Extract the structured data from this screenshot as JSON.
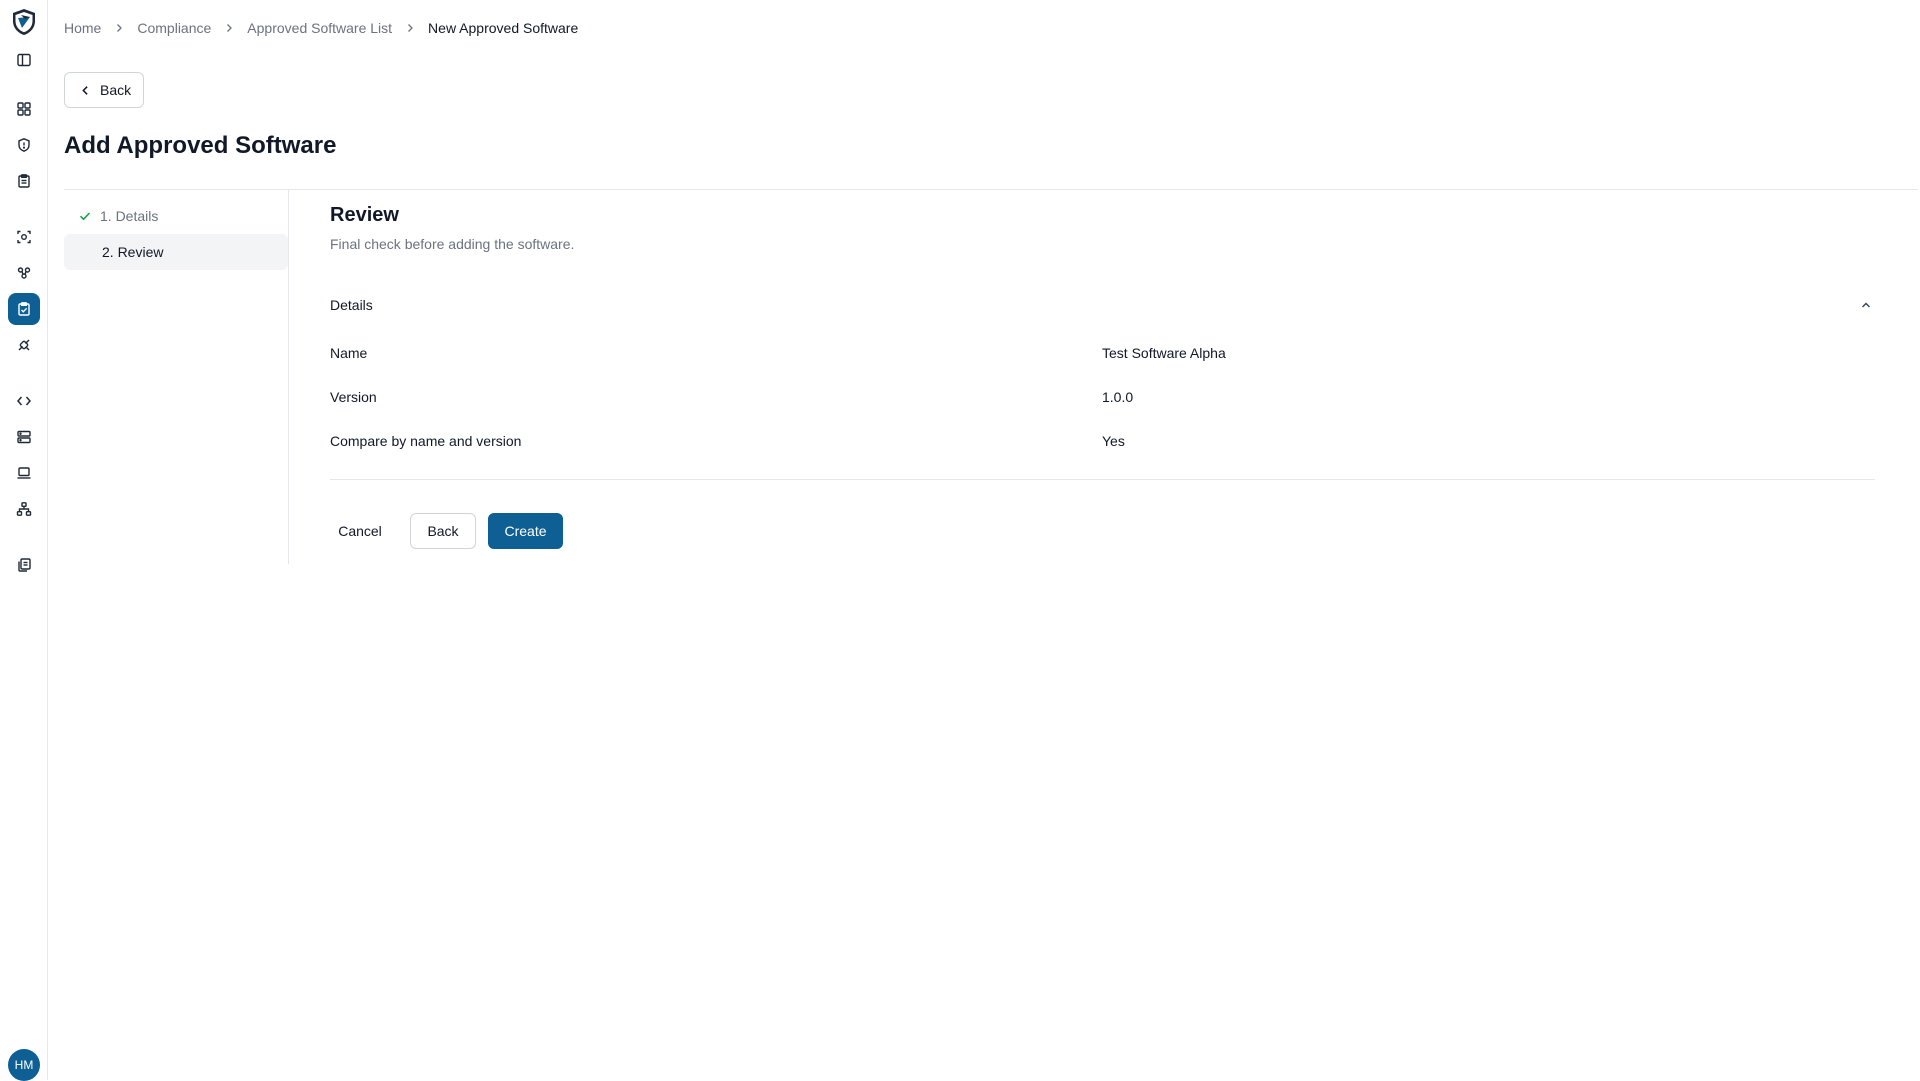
{
  "app": {
    "user_initials": "HM",
    "accent_color": "#0e5f93"
  },
  "rail": {
    "icons": [
      "sidebar-toggle-icon",
      "dashboard-icon",
      "shield-icon",
      "clipboard-icon",
      "scan-icon",
      "groups-icon",
      "compliance-icon",
      "integrations-icon",
      "code-icon",
      "servers-icon",
      "laptop-icon",
      "network-icon",
      "reports-icon"
    ],
    "active": "compliance-icon"
  },
  "breadcrumb": {
    "items": [
      "Home",
      "Compliance",
      "Approved Software List"
    ],
    "current": "New Approved Software"
  },
  "header": {
    "back_label": "Back",
    "title": "Add Approved Software"
  },
  "steps": [
    {
      "label": "1. Details",
      "status": "complete"
    },
    {
      "label": "2. Review",
      "status": "current"
    }
  ],
  "review": {
    "title": "Review",
    "subtitle": "Final check before adding the software.",
    "section_title": "Details",
    "rows": [
      {
        "label": "Name",
        "value": "Test Software Alpha"
      },
      {
        "label": "Version",
        "value": "1.0.0"
      },
      {
        "label": "Compare by name and version",
        "value": "Yes"
      }
    ]
  },
  "actions": {
    "cancel": "Cancel",
    "back": "Back",
    "create": "Create"
  }
}
